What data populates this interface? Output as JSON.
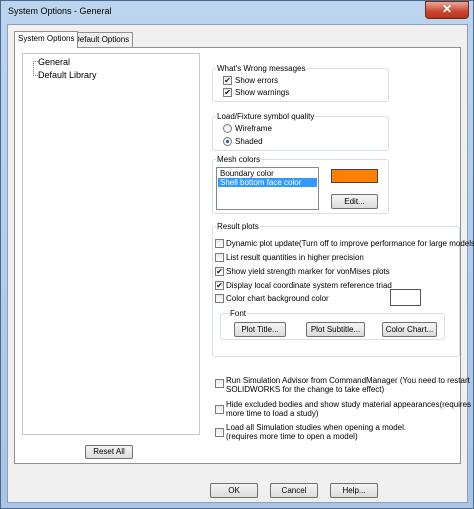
{
  "window": {
    "title": "System Options - General",
    "close_glyph": "✕"
  },
  "tabs": [
    {
      "label": "System Options",
      "active": true
    },
    {
      "label": "Default Options",
      "active": false
    }
  ],
  "tree": {
    "items": [
      "General",
      "Default Library"
    ]
  },
  "whats_wrong": {
    "title": "What's Wrong messages",
    "show_errors": {
      "label": "Show errors",
      "checked": true
    },
    "show_warnings": {
      "label": "Show warnings",
      "checked": true
    }
  },
  "load_fixture": {
    "title": "Load/Fixture symbol quality",
    "wireframe": {
      "label": "Wireframe",
      "selected": false
    },
    "shaded": {
      "label": "Shaded",
      "selected": true
    }
  },
  "mesh_colors": {
    "title": "Mesh colors",
    "items": [
      "Boundary color",
      "Shell bottom face color"
    ],
    "selected_index": 1,
    "swatch_color": "#ff8000",
    "edit_label": "Edit..."
  },
  "result_plots": {
    "title": "Result plots",
    "options": [
      {
        "label": "Dynamic plot update(Turn off to improve performance for large models",
        "checked": false
      },
      {
        "label": "List result quantities in higher precision",
        "checked": false
      },
      {
        "label": "Show yield strength marker for vonMises plots",
        "checked": true
      },
      {
        "label": "Display local coordinate system reference triad",
        "checked": true
      },
      {
        "label": "Color chart background color",
        "checked": false
      }
    ],
    "bg_swatch_color": "#ffffff",
    "font": {
      "title": "Font",
      "plot_title_label": "Plot Title...",
      "plot_subtitle_label": "Plot Subtitle...",
      "color_chart_label": "Color Chart..."
    }
  },
  "extra_options": [
    {
      "line1": "Run Simulation Advisor from CommandManager (You need to restart",
      "line2": "SOLIDWORKS for the change to take effect)",
      "checked": false
    },
    {
      "line1": "Hide excluded bodies and show study material appearances(requires",
      "line2": "more time to load a study)",
      "checked": false
    },
    {
      "line1": "Load all Simulation studies when opening a model.",
      "line2": "(requires more time to open a model)",
      "checked": false
    }
  ],
  "reset_all_label": "Reset All",
  "footer": {
    "ok_label": "OK",
    "cancel_label": "Cancel",
    "help_label": "Help..."
  },
  "checkmark_glyph": "✔"
}
